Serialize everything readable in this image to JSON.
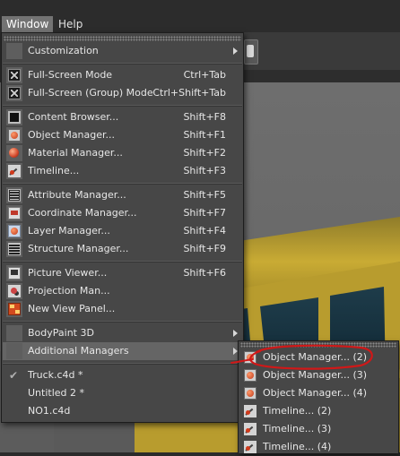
{
  "menubar": {
    "window": "Window",
    "help": "Help"
  },
  "window_menu": {
    "customization": "Customization",
    "full_screen_mode": {
      "label": "Full-Screen Mode",
      "shortcut": "Ctrl+Tab"
    },
    "full_screen_group_mode": {
      "label": "Full-Screen (Group) Mode",
      "shortcut": "Ctrl+Shift+Tab"
    },
    "content_browser": {
      "label": "Content Browser...",
      "shortcut": "Shift+F8"
    },
    "object_manager": {
      "label": "Object Manager...",
      "shortcut": "Shift+F1"
    },
    "material_manager": {
      "label": "Material Manager...",
      "shortcut": "Shift+F2"
    },
    "timeline": {
      "label": "Timeline...",
      "shortcut": "Shift+F3"
    },
    "attribute_manager": {
      "label": "Attribute Manager...",
      "shortcut": "Shift+F5"
    },
    "coordinate_manager": {
      "label": "Coordinate Manager...",
      "shortcut": "Shift+F7"
    },
    "layer_manager": {
      "label": "Layer Manager...",
      "shortcut": "Shift+F4"
    },
    "structure_manager": {
      "label": "Structure Manager...",
      "shortcut": "Shift+F9"
    },
    "picture_viewer": {
      "label": "Picture Viewer...",
      "shortcut": "Shift+F6"
    },
    "projection_man": {
      "label": "Projection Man..."
    },
    "new_view_panel": {
      "label": "New View Panel..."
    },
    "bodypaint": "BodyPaint 3D",
    "additional_managers": "Additional Managers",
    "documents": [
      {
        "label": "Truck.c4d *",
        "checked": true
      },
      {
        "label": "Untitled 2 *",
        "checked": false
      },
      {
        "label": "NO1.c4d",
        "checked": false
      }
    ]
  },
  "additional_managers_submenu": [
    {
      "label": "Object Manager... (2)",
      "icon": "object-manager-icon"
    },
    {
      "label": "Object Manager... (3)",
      "icon": "object-manager-icon"
    },
    {
      "label": "Object Manager... (4)",
      "icon": "object-manager-icon"
    },
    {
      "label": "Timeline... (2)",
      "icon": "timeline-icon"
    },
    {
      "label": "Timeline... (3)",
      "icon": "timeline-icon"
    },
    {
      "label": "Timeline... (4)",
      "icon": "timeline-icon"
    }
  ],
  "colors": {
    "annotation": "#d01818",
    "menu_bg": "#474747",
    "highlight": "#656565",
    "truck_yellow": "#c4a52f"
  }
}
